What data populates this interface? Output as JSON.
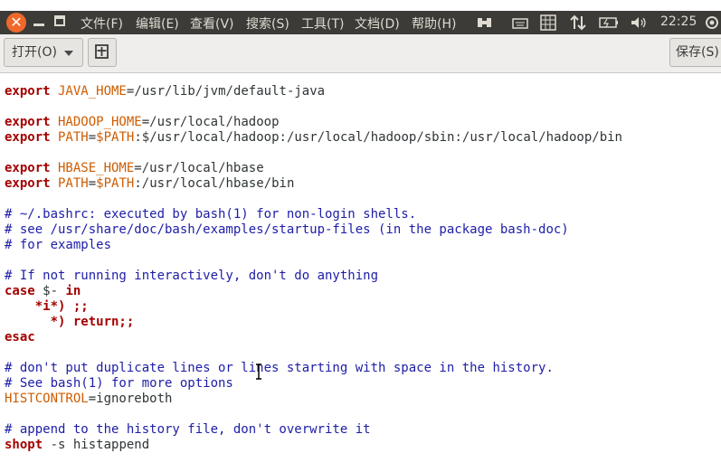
{
  "menubar": {
    "items": [
      "文件(F)",
      "编辑(E)",
      "查看(V)",
      "搜索(S)",
      "工具(T)",
      "文档(D)",
      "帮助(H)"
    ],
    "clock": "22:25",
    "tray_icons": [
      "switch-icon",
      "keyboard-icon",
      "keyboard-layout-icon",
      "network-icon",
      "battery-icon",
      "volume-icon",
      "power-icon"
    ]
  },
  "toolbar": {
    "open_label": "打开(O)",
    "save_label": "保存(S)"
  },
  "editor": {
    "lines": [
      [
        [
          "kw",
          "export"
        ],
        [
          "var",
          " JAVA_HOME"
        ],
        [
          "",
          "="
        ],
        [
          "sl",
          "/"
        ],
        [
          "",
          "usr"
        ],
        [
          "sl",
          "/"
        ],
        [
          "",
          "lib"
        ],
        [
          "sl",
          "/"
        ],
        [
          "",
          "jvm"
        ],
        [
          "sl",
          "/"
        ],
        [
          "",
          "default-java"
        ]
      ],
      [],
      [
        [
          "kw",
          "export"
        ],
        [
          "var",
          " HADOOP_HOME"
        ],
        [
          "",
          "="
        ],
        [
          "sl",
          "/"
        ],
        [
          "",
          "usr"
        ],
        [
          "sl",
          "/"
        ],
        [
          "",
          "local"
        ],
        [
          "sl",
          "/"
        ],
        [
          "",
          "hadoop"
        ]
      ],
      [
        [
          "kw",
          "export"
        ],
        [
          "var",
          " PATH"
        ],
        [
          "",
          "="
        ],
        [
          "var",
          "$PATH"
        ],
        [
          "",
          ":"
        ],
        [
          "sl",
          "$/"
        ],
        [
          "",
          "usr"
        ],
        [
          "sl",
          "/"
        ],
        [
          "",
          "local"
        ],
        [
          "sl",
          "/"
        ],
        [
          "",
          "hadoop:"
        ],
        [
          "sl",
          "/"
        ],
        [
          "",
          "usr"
        ],
        [
          "sl",
          "/"
        ],
        [
          "",
          "local"
        ],
        [
          "sl",
          "/"
        ],
        [
          "",
          "hadoop"
        ],
        [
          "sl",
          "/"
        ],
        [
          "",
          "sbin:"
        ],
        [
          "sl",
          "/"
        ],
        [
          "",
          "usr"
        ],
        [
          "sl",
          "/"
        ],
        [
          "",
          "local"
        ],
        [
          "sl",
          "/"
        ],
        [
          "",
          "hadoop"
        ],
        [
          "sl",
          "/"
        ],
        [
          "",
          "bin"
        ]
      ],
      [],
      [
        [
          "kw",
          "export"
        ],
        [
          "var",
          " HBASE_HOME"
        ],
        [
          "",
          "="
        ],
        [
          "sl",
          "/"
        ],
        [
          "",
          "usr"
        ],
        [
          "sl",
          "/"
        ],
        [
          "",
          "local"
        ],
        [
          "sl",
          "/"
        ],
        [
          "",
          "hbase"
        ]
      ],
      [
        [
          "kw",
          "export"
        ],
        [
          "var",
          " PATH"
        ],
        [
          "",
          "="
        ],
        [
          "var",
          "$PATH"
        ],
        [
          "",
          ":"
        ],
        [
          "sl",
          "/"
        ],
        [
          "",
          "usr"
        ],
        [
          "sl",
          "/"
        ],
        [
          "",
          "local"
        ],
        [
          "sl",
          "/"
        ],
        [
          "",
          "hbase"
        ],
        [
          "sl",
          "/"
        ],
        [
          "",
          "bin"
        ]
      ],
      [],
      [
        [
          "cm",
          "# ~/.bashrc: executed by bash(1) for non-login shells."
        ]
      ],
      [
        [
          "cm",
          "# see /usr/share/doc/bash/examples/startup-files (in the package bash-doc)"
        ]
      ],
      [
        [
          "cm",
          "# for examples"
        ]
      ],
      [],
      [
        [
          "cm",
          "# If not running interactively, don't do anything"
        ]
      ],
      [
        [
          "kw",
          "case"
        ],
        [
          "",
          " $- "
        ],
        [
          "kw",
          "in"
        ]
      ],
      [
        [
          "",
          "    "
        ],
        [
          "kw",
          "*i*) ;;"
        ]
      ],
      [
        [
          "",
          "      "
        ],
        [
          "kw",
          "*) return;;"
        ]
      ],
      [
        [
          "kw",
          "esac"
        ]
      ],
      [],
      [
        [
          "cm",
          "# don't put duplicate lines or lines starting with space in the history."
        ]
      ],
      [
        [
          "cm",
          "# See bash(1) for more options"
        ]
      ],
      [
        [
          "var",
          "HISTCONTROL"
        ],
        [
          "",
          "=ignoreboth"
        ]
      ],
      [],
      [
        [
          "cm",
          "# append to the history file, don't overwrite it"
        ]
      ],
      [
        [
          "kw",
          "shopt"
        ],
        [
          "",
          " -s histappend"
        ]
      ]
    ]
  }
}
